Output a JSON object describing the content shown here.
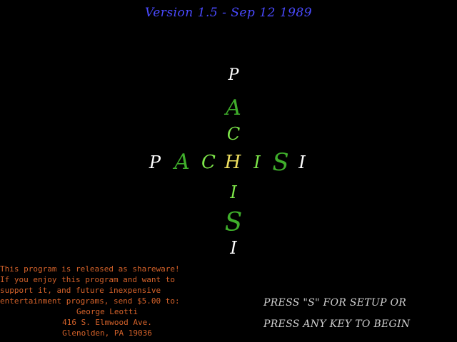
{
  "version_text": "Version 1.5 - Sep 12 1989",
  "title": {
    "horizontal": [
      {
        "char": "P",
        "color": "#ffffff"
      },
      {
        "char": "A",
        "color": "#3fae2b"
      },
      {
        "char": "C",
        "color": "#7ee84a"
      },
      {
        "char": "H",
        "color": "#f0e060"
      },
      {
        "char": "I",
        "color": "#7ee84a"
      },
      {
        "char": "S",
        "color": "#3fae2b"
      },
      {
        "char": "I",
        "color": "#ffffff"
      }
    ],
    "vertical": [
      {
        "char": "P",
        "color": "#ffffff"
      },
      {
        "char": "A",
        "color": "#3fae2b"
      },
      {
        "char": "C",
        "color": "#7ee84a"
      },
      {
        "char": "H",
        "color": "#f0e060"
      },
      {
        "char": "I",
        "color": "#7ee84a"
      },
      {
        "char": "S",
        "color": "#3fae2b"
      },
      {
        "char": "I",
        "color": "#ffffff"
      }
    ]
  },
  "shareware": {
    "line1": "This program is released as shareware!",
    "line2": "If you enjoy this program and want to",
    "line3": "support it, and future inexpensive",
    "line4": "entertainment programs, send $5.00 to:",
    "name": "George Leotti",
    "street": "416 S. Elmwood Ave.",
    "city": "Glenolden, PA 19036"
  },
  "prompts": {
    "setup": "PRESS \"S\" FOR SETUP OR",
    "begin": "PRESS ANY KEY TO BEGIN"
  },
  "colors": {
    "background": "#000000",
    "version": "#4a4aff",
    "shareware": "#d4622a",
    "prompt": "#d0d0d0"
  }
}
